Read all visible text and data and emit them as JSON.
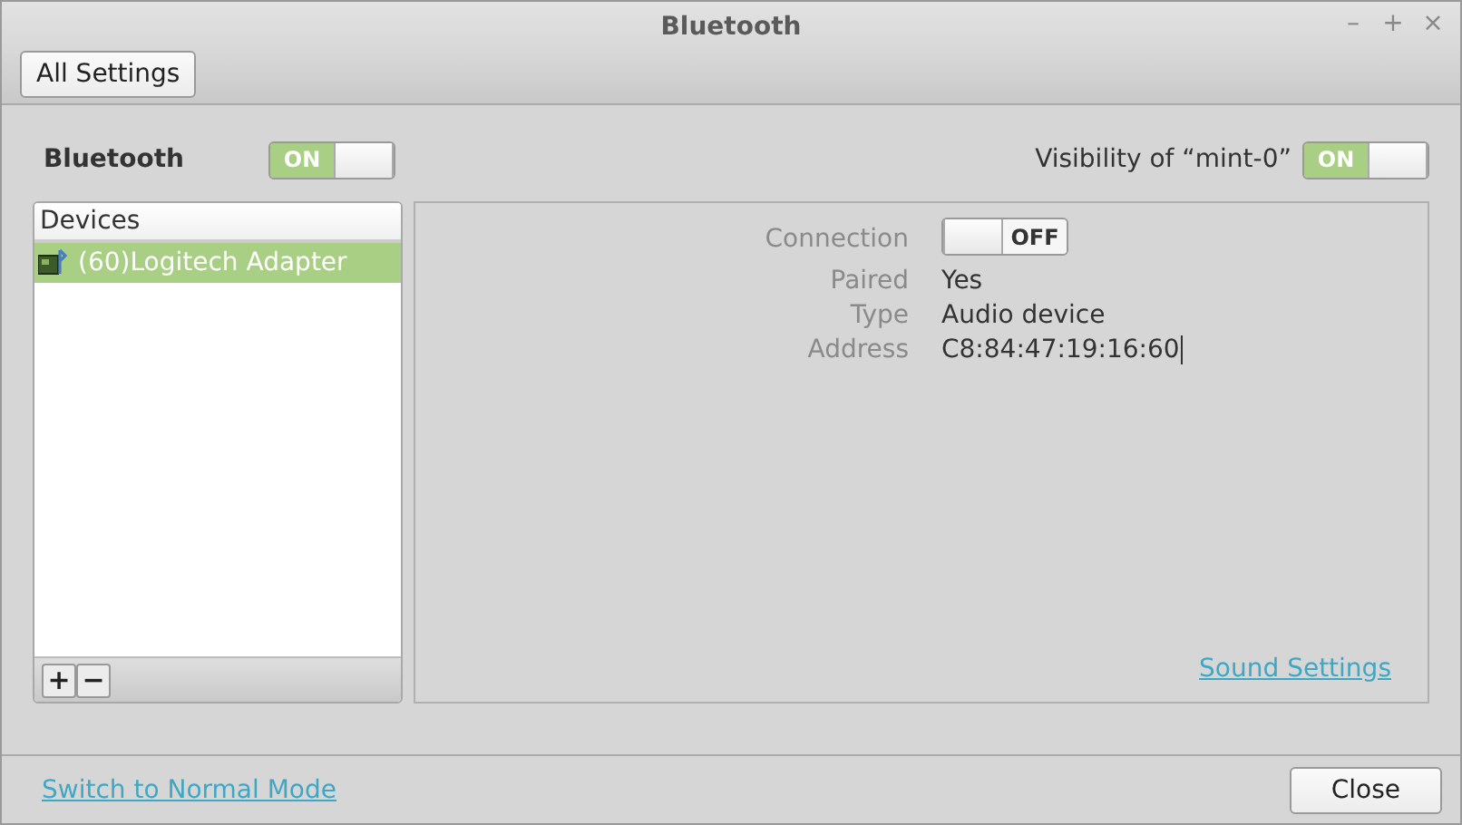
{
  "window": {
    "title": "Bluetooth",
    "controls": [
      "–",
      "+",
      "×"
    ]
  },
  "toolbar": {
    "button": "All Settings"
  },
  "bluetooth": {
    "label": "Bluetooth",
    "switch": {
      "on": true,
      "text": "ON"
    }
  },
  "visibility": {
    "label": "Visibility of “mint-0”",
    "switch": {
      "on": true,
      "text": "ON"
    }
  },
  "devices": {
    "header": "Devices",
    "items": [
      {
        "name": "(60)Logitech Adapter",
        "selected": true
      }
    ],
    "add": "+",
    "remove": "−"
  },
  "details": {
    "rows": [
      {
        "kind": "switch",
        "label": "Connection",
        "on": false,
        "text": "OFF"
      },
      {
        "kind": "text",
        "label": "Paired",
        "value": "Yes"
      },
      {
        "kind": "text",
        "label": "Type",
        "value": "Audio device"
      },
      {
        "kind": "text",
        "label": "Address",
        "value": "C8:84:47:19:16:60"
      }
    ],
    "link": "Sound Settings"
  },
  "footer": {
    "link": "Switch to Normal Mode",
    "button": "Close"
  }
}
